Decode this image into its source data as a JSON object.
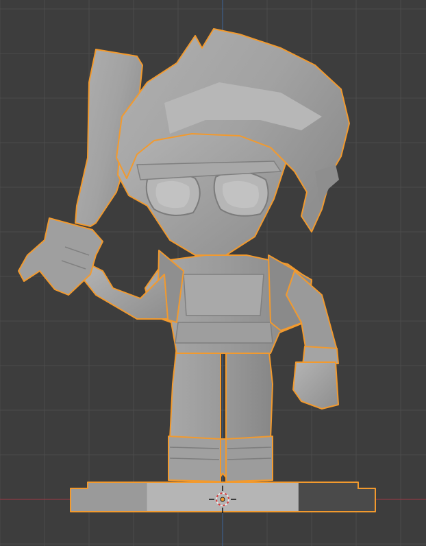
{
  "viewport": {
    "background_color": "#3d3d3d",
    "grid_color": "#4b4b4b",
    "x_axis_color": "#8c3b44",
    "y_axis_color": "#3e5f8a"
  },
  "selection": {
    "outline_color": "#f29a2e",
    "selected_object": "character-figurine"
  },
  "model": {
    "base_color": "#9b9b9b",
    "shade_light": "#b2b2b2",
    "shade_dark": "#7a7a7a"
  },
  "cursor_3d": {
    "icon": "3d-cursor-icon",
    "ring_colors": [
      "#e8e8e8",
      "#d83a3a"
    ]
  }
}
